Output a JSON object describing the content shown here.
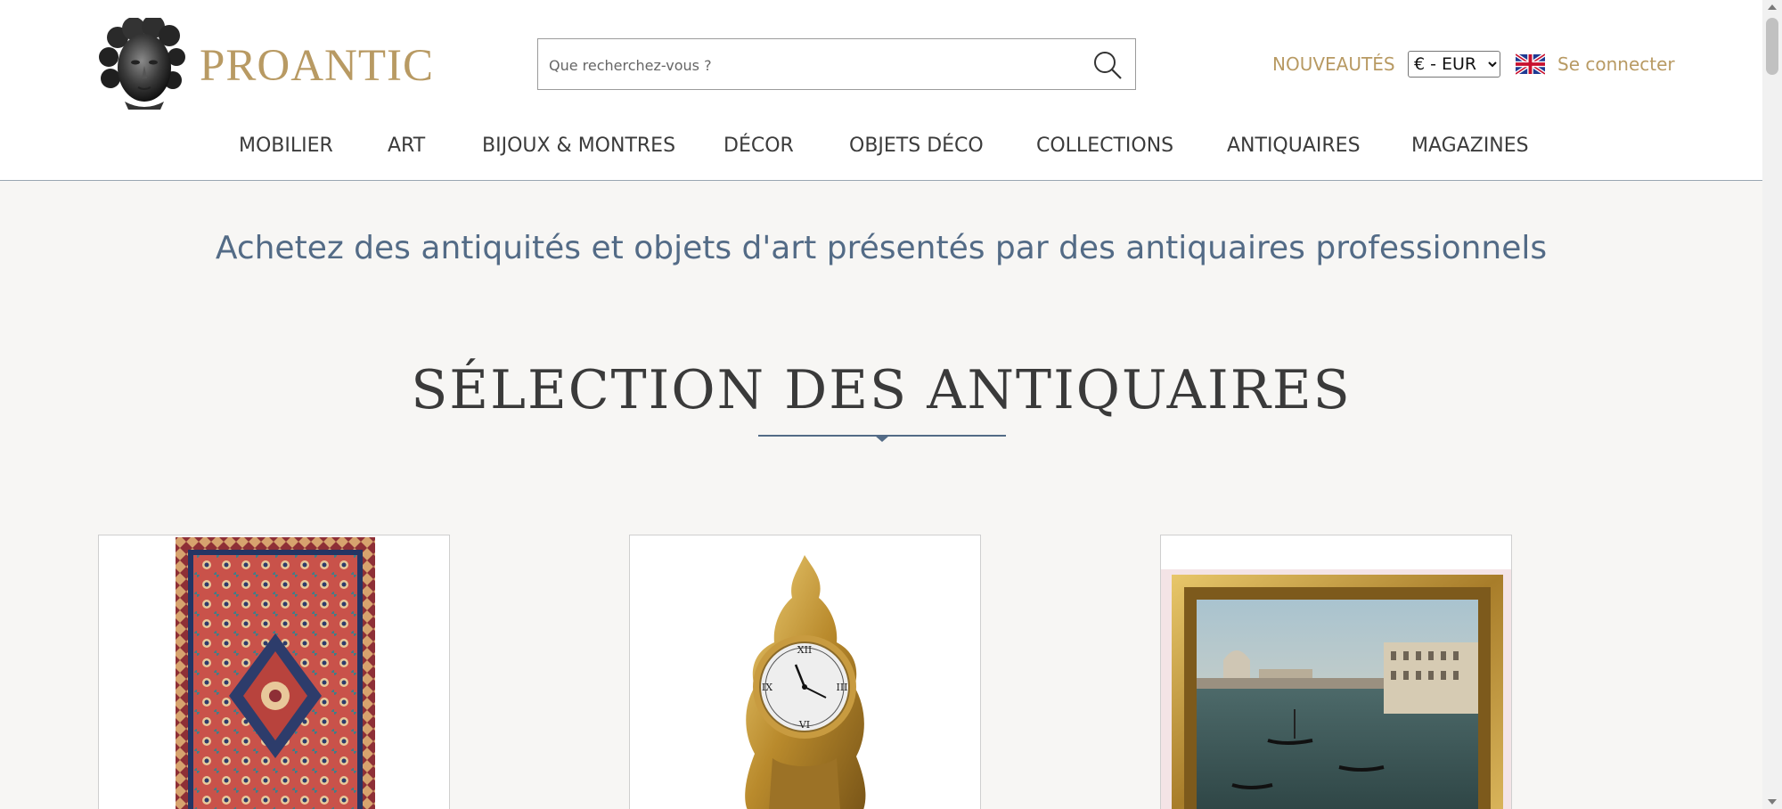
{
  "brand": {
    "name": "PROANTIC",
    "logo_icon": "sculpted-head-logo"
  },
  "search": {
    "placeholder": "Que recherchez-vous ?",
    "icon": "search-icon"
  },
  "header_links": {
    "new": "NOUVEAUTÉS",
    "login": "Se connecter",
    "language_flag": "uk-flag-icon"
  },
  "currency": {
    "selected": "€ - EUR",
    "options": [
      "€ - EUR"
    ]
  },
  "nav": [
    "MOBILIER",
    "ART",
    "BIJOUX & MONTRES",
    "DÉCOR",
    "OBJETS DÉCO",
    "COLLECTIONS",
    "ANTIQUAIRES",
    "MAGAZINES"
  ],
  "tagline": "Achetez des antiquités et objets d'art présentés par des antiquaires professionnels",
  "section": {
    "title": "SÉLECTION DES ANTIQUAIRES"
  },
  "products": [
    {
      "image": "persian-rug"
    },
    {
      "image": "gilt-bronze-cartel-clock"
    },
    {
      "image": "venice-painting-gilt-frame"
    }
  ],
  "colors": {
    "brand_gold": "#b89a63",
    "tagline_blue": "#536b86",
    "background": "#f7f6f4"
  }
}
